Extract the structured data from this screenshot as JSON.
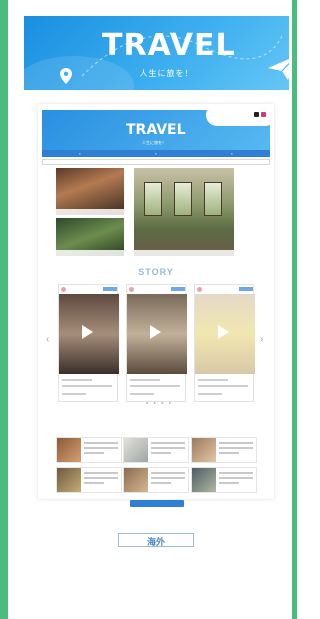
{
  "banner": {
    "title": "TRAVEL",
    "subtitle": "人生に旅を！"
  },
  "preview": {
    "title": "TRAVEL",
    "subtitle": "人生に旅を！",
    "section_title": "STORY",
    "footer_badge": "海外"
  },
  "colors": {
    "strip": "#4cbb80",
    "banner_blue": "#1a8fe0",
    "nav_blue": "#2f7fd4"
  }
}
